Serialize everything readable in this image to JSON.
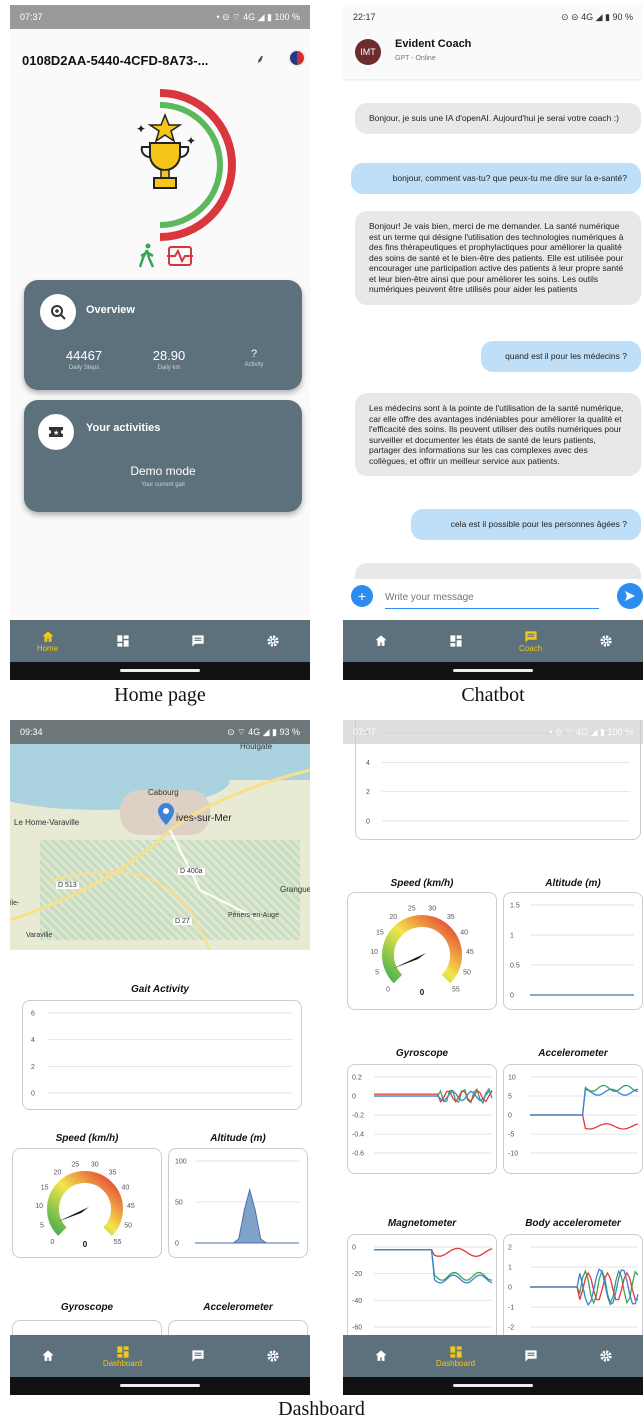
{
  "captions": {
    "home": "Home page",
    "chatbot": "Chatbot",
    "dashboard": "Dashboard"
  },
  "home": {
    "status_time": "07:37",
    "status_right": "• ⊝ ⌔ 4G ◢ ▮ 100 %",
    "device_id": "0108D2AA-5440-4CFD-8A73-...",
    "overview": {
      "title": "Overview",
      "stats": [
        {
          "value": "44467",
          "label": "Daily Steps"
        },
        {
          "value": "28.90",
          "label": "Daily km"
        },
        {
          "value": "?",
          "label": "Activity"
        }
      ]
    },
    "activities": {
      "title": "Your activities",
      "mode": "Demo mode",
      "sub": "Your current gait"
    }
  },
  "chat": {
    "status_time": "22:17",
    "status_right": "⊙ ⊝ 4G ◢ ▮ 90 %",
    "avatar": "IMT",
    "name": "Evident Coach",
    "status": "GPT - Online",
    "messages": [
      {
        "role": "bot",
        "text": "Bonjour, je suis une IA d'openAI. Aujourd'hui je serai votre coach :)"
      },
      {
        "role": "user",
        "text": "bonjour, comment vas-tu? que peux-tu me dire sur la e-santé?"
      },
      {
        "role": "bot",
        "text": "Bonjour! Je vais bien, merci de me demander. La santé numérique est un terme qui désigne l'utilisation des technologies numériques à des fins thérapeutiques et prophylactiques pour améliorer la qualité des soins de santé et le bien-être des patients. Elle est utilisée pour encourager une participation active des patients à leur propre santé et leur bien-être ainsi que pour améliorer les soins. Les outils numériques peuvent être utilisés pour aider les patients"
      },
      {
        "role": "user",
        "text": "quand est il pour les médecins ?"
      },
      {
        "role": "bot",
        "text": "Les médecins sont à la pointe de l'utilisation de la santé numérique, car elle offre des avantages indéniables pour améliorer la qualité et l'efficacité des soins. Ils peuvent utiliser des outils numériques pour surveiller et documenter les états de santé de leurs patients, partager des informations sur les cas complexes avec des collègues, et offrir un meilleur service aux patients."
      },
      {
        "role": "user",
        "text": "cela est il possible pour les personnes âgées ?"
      }
    ],
    "input_placeholder": "Write your message"
  },
  "nav": {
    "home": "Home",
    "dashboard": "Dashboard",
    "coach": "Coach"
  },
  "dash1": {
    "status_time": "09:34",
    "status_right": "⊙ ⌔ 4G ◢ ▮ 93 %",
    "map_labels": [
      "Houlgate",
      "Cabourg",
      "Le Home-Varaville",
      "ives-sur-Mer",
      "D 400a",
      "D 513",
      "Grangues",
      "D 27",
      "Périers-en-Auge",
      "Varaville",
      "ile-"
    ],
    "gait_title": "Gait Activity",
    "speed_title": "Speed (km/h)",
    "altitude_title": "Altitude (m)",
    "gyro_title": "Gyroscope",
    "accel_title": "Accelerometer"
  },
  "dash2": {
    "status_time": "07:37",
    "status_right": "• ⊝ ⌔ 4G ◢ ▮ 100 %",
    "speed_title": "Speed (km/h)",
    "altitude_title": "Altitude (m)",
    "gyro_title": "Gyroscope",
    "accel_title": "Accelerometer",
    "mag_title": "Magnetometer",
    "body_title": "Body accelerometer"
  },
  "chart_data": [
    {
      "type": "line",
      "title": "Gait Activity",
      "ylim": [
        0,
        6
      ],
      "yticks": [
        "0",
        "2",
        "4",
        "6"
      ],
      "series": []
    },
    {
      "type": "area",
      "title": "Altitude (m)",
      "ylim": [
        0,
        100
      ],
      "yticks": [
        "0",
        "50",
        "100"
      ],
      "series": [
        {
          "values": [
            0,
            0,
            0,
            0,
            0,
            0,
            0,
            0,
            5,
            40,
            65,
            40,
            5,
            0,
            0,
            0,
            0,
            0,
            0,
            0
          ]
        }
      ]
    },
    {
      "type": "gauge",
      "title": "Speed (km/h)",
      "ticks": [
        "0",
        "5",
        "10",
        "15",
        "20",
        "25",
        "30",
        "35",
        "40",
        "45",
        "50",
        "55"
      ],
      "value": 0
    },
    {
      "type": "line",
      "title": "Altitude (m)",
      "ylim": [
        0,
        1.5
      ],
      "yticks": [
        "0",
        "0.5",
        "1",
        "1.5"
      ],
      "series": [
        {
          "values": [
            0,
            0,
            0,
            0,
            0,
            0,
            0,
            0,
            0,
            0
          ]
        }
      ]
    },
    {
      "type": "line",
      "title": "Gyroscope",
      "ylim": [
        -0.6,
        0.2
      ],
      "yticks": [
        "0.2",
        "0",
        "-0.2",
        "-0.4",
        "-0.6"
      ]
    },
    {
      "type": "line",
      "title": "Accelerometer",
      "ylim": [
        -10,
        10
      ],
      "yticks": [
        "10",
        "5",
        "0",
        "-5",
        "-10"
      ]
    },
    {
      "type": "line",
      "title": "Magnetometer",
      "ylim": [
        -60,
        0
      ],
      "yticks": [
        "0",
        "-20",
        "-40",
        "-60"
      ]
    },
    {
      "type": "line",
      "title": "Body accelerometer",
      "ylim": [
        -2,
        2
      ],
      "yticks": [
        "2",
        "1",
        "0",
        "-1",
        "-2"
      ]
    }
  ]
}
